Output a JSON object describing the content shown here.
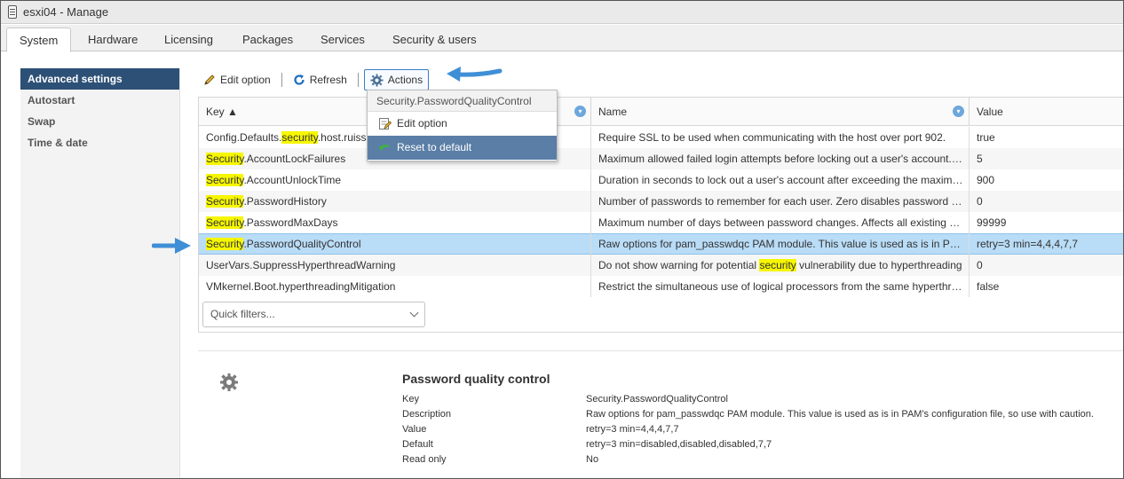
{
  "window": {
    "title": "esxi04 - Manage"
  },
  "tabs": [
    {
      "label": "System",
      "active": true
    },
    {
      "label": "Hardware"
    },
    {
      "label": "Licensing"
    },
    {
      "label": "Packages"
    },
    {
      "label": "Services"
    },
    {
      "label": "Security & users"
    }
  ],
  "sidebar": {
    "items": [
      {
        "label": "Advanced settings",
        "active": true
      },
      {
        "label": "Autostart"
      },
      {
        "label": "Swap"
      },
      {
        "label": "Time & date"
      }
    ]
  },
  "toolbar": {
    "edit_label": "Edit option",
    "refresh_label": "Refresh",
    "actions_label": "Actions"
  },
  "grid": {
    "headers": {
      "key": "Key ▲",
      "name": "Name",
      "value": "Value"
    },
    "rows": [
      {
        "key_pre": "Config.Defaults.",
        "key_hl": "security",
        "key_post": ".host.ruissl",
        "name_pre": "Require SSL to be used when communicating with the host over port 902.",
        "name_hl": "",
        "name_post": "",
        "value": "true"
      },
      {
        "key_pre": "",
        "key_hl": "Security",
        "key_post": ".AccountLockFailures",
        "name_pre": "Maximum allowed failed login attempts before locking out a user's account.…",
        "name_hl": "",
        "name_post": "",
        "value": "5"
      },
      {
        "key_pre": "",
        "key_hl": "Security",
        "key_post": ".AccountUnlockTime",
        "name_pre": "Duration in seconds to lock out a user's account after exceeding the maxim…",
        "name_hl": "",
        "name_post": "",
        "value": "900"
      },
      {
        "key_pre": "",
        "key_hl": "Security",
        "key_post": ".PasswordHistory",
        "name_pre": "Number of passwords to remember for each user. Zero disables password …",
        "name_hl": "",
        "name_post": "",
        "value": "0"
      },
      {
        "key_pre": "",
        "key_hl": "Security",
        "key_post": ".PasswordMaxDays",
        "name_pre": "Maximum number of days between password changes. Affects all existing …",
        "name_hl": "",
        "name_post": "",
        "value": "99999"
      },
      {
        "key_pre": "",
        "key_hl": "Security",
        "key_post": ".PasswordQualityControl",
        "name_pre": "Raw options for pam_passwdqc PAM module. This value is used as is in P…",
        "name_hl": "",
        "name_post": "",
        "value": "retry=3 min=4,4,4,7,7",
        "selected": true
      },
      {
        "key_pre": "UserVars.SuppressHyperthreadWarning",
        "key_hl": "",
        "key_post": "",
        "name_pre": "Do not show warning for potential ",
        "name_hl": "security",
        "name_post": " vulnerability due to hyperthreading",
        "value": "0"
      },
      {
        "key_pre": "VMkernel.Boot.hyperthreadingMitigation",
        "key_hl": "",
        "key_post": "",
        "name_pre": "Restrict the simultaneous use of logical processors from the same hyperthr…",
        "name_hl": "",
        "name_post": "",
        "value": "false"
      }
    ],
    "quick_filter_placeholder": "Quick filters..."
  },
  "menu": {
    "title": "Security.PasswordQualityControl",
    "items": [
      {
        "label": "Edit option"
      },
      {
        "label": "Reset to default",
        "hover": true
      }
    ]
  },
  "details": {
    "title": "Password quality control",
    "fields": [
      {
        "label": "Key",
        "value": "Security.PasswordQualityControl"
      },
      {
        "label": "Description",
        "value": "Raw options for pam_passwdqc PAM module. This value is used as is in PAM's configuration file, so use with caution."
      },
      {
        "label": "Value",
        "value": "retry=3 min=4,4,4,7,7"
      },
      {
        "label": "Default",
        "value": "retry=3 min=disabled,disabled,disabled,7,7"
      },
      {
        "label": "Read only",
        "value": "No"
      }
    ]
  },
  "colors": {
    "accent": "#2d5076",
    "selected_row": "#b9dcf7",
    "highlight": "#f6f600",
    "arrow": "#3f8fd6"
  },
  "icons": [
    "host-icon",
    "pencil-icon",
    "refresh-icon",
    "gear-icon",
    "filter-icon",
    "edit-note-icon",
    "reset-icon",
    "chevron-down-icon"
  ]
}
